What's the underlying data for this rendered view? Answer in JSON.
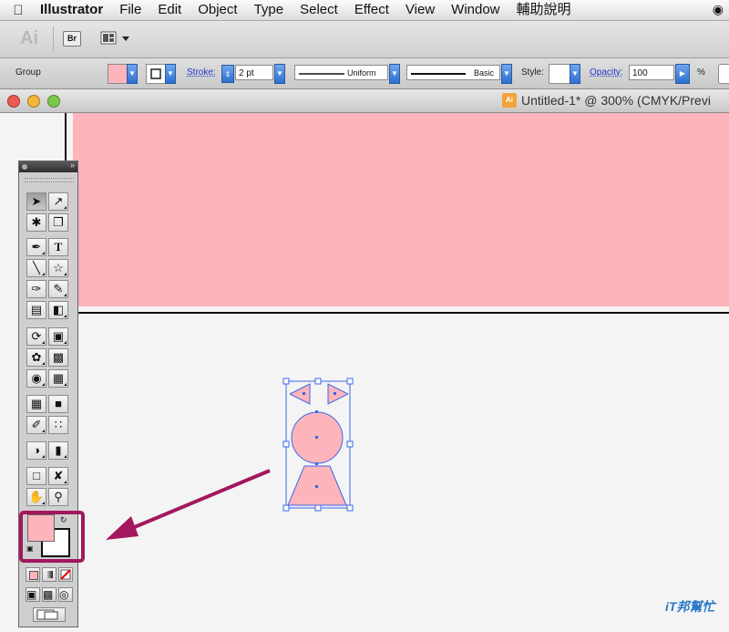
{
  "menubar": {
    "apple_icon": "apple-logo-icon",
    "items": [
      "Illustrator",
      "File",
      "Edit",
      "Object",
      "Type",
      "Select",
      "Effect",
      "View",
      "Window",
      "輔助說明"
    ]
  },
  "appbar": {
    "logo": "Ai",
    "bridge_label": "Br"
  },
  "control": {
    "selection_type": "Group",
    "fill_color": "#feb4bb",
    "stroke_label": "Stroke:",
    "stroke_weight": "2 pt",
    "profile_label": "Uniform",
    "brush_label": "Basic",
    "style_label": "Style:",
    "opacity_label": "Opacity:",
    "opacity_value": "100",
    "percent": "%"
  },
  "document": {
    "title": "Untitled-1* @ 300% (CMYK/Previ",
    "doc_icon_label": "Ai"
  },
  "colors": {
    "accent_pink": "#feb4bb",
    "highlight": "#a3175e",
    "selection_blue": "#3a66e8"
  },
  "tools_panel": {
    "text_tool": "T"
  },
  "watermark": "iT邦幫忙"
}
